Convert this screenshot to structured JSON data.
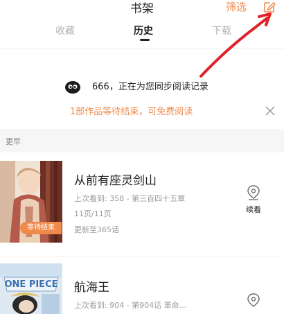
{
  "header": {
    "title": "书架",
    "filter_label": "筛选"
  },
  "tabs": [
    {
      "label": "收藏",
      "active": false
    },
    {
      "label": "历史",
      "active": true
    },
    {
      "label": "下载",
      "active": false
    }
  ],
  "sync": {
    "text": "666，正在为您同步阅读记录"
  },
  "notice": {
    "text": "1部作品等待结束，可免费阅读"
  },
  "section": {
    "label": "更早"
  },
  "books": [
    {
      "title": "从前有座灵剑山",
      "last_read": "上次看到: 358 - 第三百四十五章",
      "pages": "11页/11页",
      "update": "更新至365话",
      "badge": "等待结束",
      "action_label": "续看"
    },
    {
      "title": "航海王",
      "last_read": "上次看到: 904 - 第904话 革命..."
    }
  ],
  "colors": {
    "accent": "#f08a4b",
    "annotation": "#e0232a"
  }
}
